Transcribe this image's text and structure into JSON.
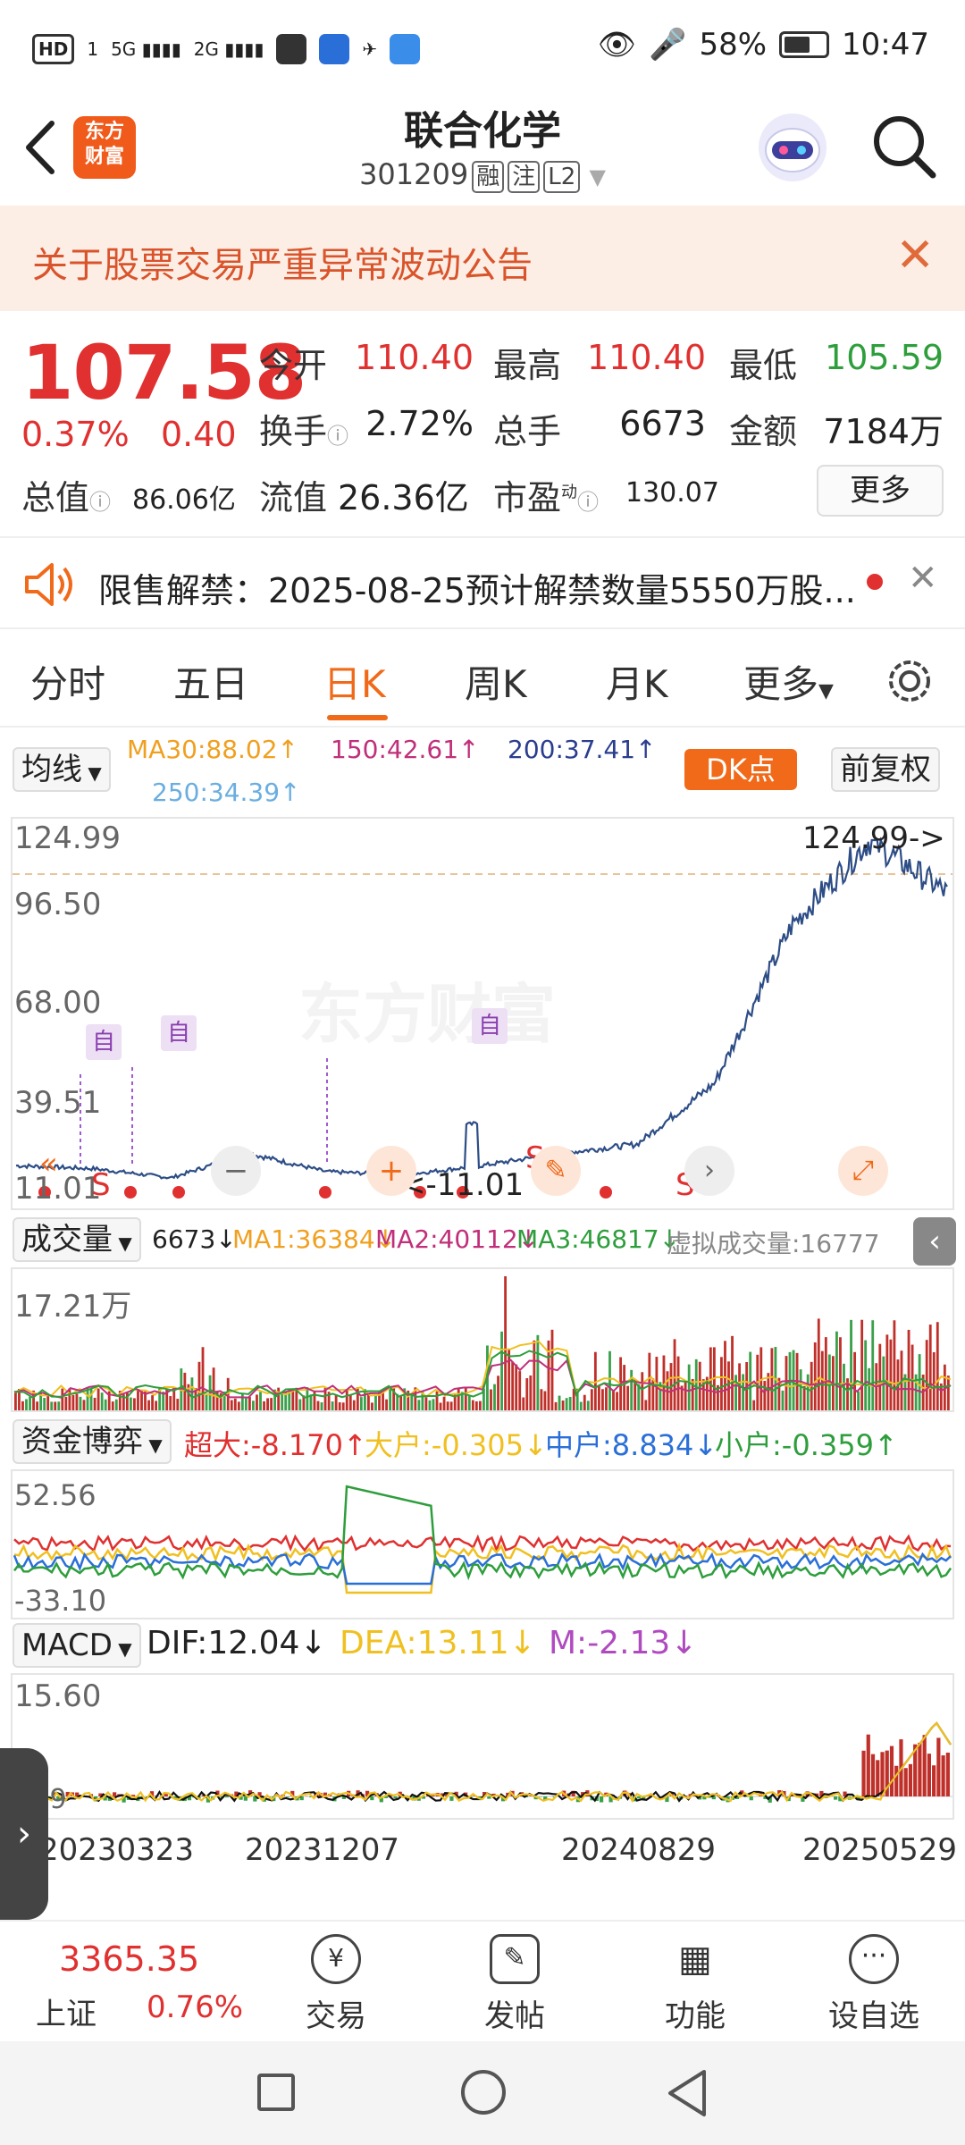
{
  "status_bar": {
    "hd": "HD",
    "sim": "1",
    "net1": "5G",
    "net2": "2G",
    "battery_pct": "58%",
    "time": "10:47"
  },
  "header": {
    "title": "联合化学",
    "code": "301209",
    "tags": [
      "融",
      "注",
      "L2"
    ],
    "logo_text": "东方财富"
  },
  "notice": {
    "text": "关于股票交易严重异常波动公告"
  },
  "quote": {
    "price": "107.58",
    "change_pct": "0.37%",
    "change": "0.40",
    "open_label": "今开",
    "open": "110.40",
    "high_label": "最高",
    "high": "110.40",
    "low_label": "最低",
    "low": "105.59",
    "turnover_label": "换手",
    "turnover": "2.72%",
    "volume_label": "总手",
    "volume": "6673",
    "amount_label": "金额",
    "amount": "7184万",
    "mktcap_label": "总值",
    "mktcap": "86.06亿",
    "float_label": "流值",
    "float": "26.36亿",
    "pe_label": "市盈",
    "pe_sup": "动",
    "pe": "130.07",
    "more": "更多"
  },
  "restriction": {
    "text": "限售解禁：2025-08-25预计解禁数量5550万股..."
  },
  "tabs": [
    "分时",
    "五日",
    "日K",
    "周K",
    "月K",
    "更多"
  ],
  "active_tab": "日K",
  "ma": {
    "select": "均线",
    "ma30": "MA30:88.02↑",
    "ma150": "150:42.61↑",
    "ma200": "200:37.41↑",
    "ma250": "250:34.39↑",
    "dk": "DK点",
    "fq": "前复权"
  },
  "kchart": {
    "y_labels": [
      "124.99",
      "96.50",
      "68.00",
      "39.51",
      "11.01"
    ],
    "max_marker": "124.99->",
    "min_marker": "<-11.01",
    "tag": "自",
    "sell_tag": "S",
    "watermark": "东方财富"
  },
  "volume_panel": {
    "select": "成交量",
    "vol": "6673↓",
    "ma1": "MA1:36384↓",
    "ma2": "MA2:40112↓",
    "ma3": "MA3:46817↓",
    "virtual": "虚拟成交量:16777",
    "ymax": "17.21万"
  },
  "fund_panel": {
    "select": "资金博弈",
    "super": "超大:-8.170↑",
    "big": "大户:-0.305↓",
    "mid": "中户:8.834↓",
    "small": "小户:-0.359↑",
    "ymax": "52.56",
    "ymin": "-33.10"
  },
  "macd_panel": {
    "select": "MACD",
    "dif": "DIF:12.04↓",
    "dea": "DEA:13.11↓",
    "m": "M:-2.13↓",
    "ymax": "15.60",
    "ymin": "-.79"
  },
  "dates": [
    "20230323",
    "20231207",
    "20240829",
    "20250529"
  ],
  "bottom_nav": {
    "index_value": "3365.35",
    "index_name": "上证",
    "index_pct": "0.76%",
    "items": [
      "交易",
      "发帖",
      "功能",
      "设自选"
    ]
  },
  "colors": {
    "accent": "#f06a1a",
    "up": "#e03030",
    "down": "#2e9e3c",
    "kline": "#2d4d86",
    "ma30": "#f0a020",
    "ma150": "#c0307a",
    "ma200": "#2a3d8f",
    "ma250": "#6aaee0"
  },
  "chart_data": [
    {
      "type": "line",
      "title": "",
      "ylim": [
        11.01,
        124.99
      ],
      "x": [
        "20230323",
        "20231207",
        "20240829",
        "20250529"
      ],
      "series": [
        {
          "values": [
            18,
            17,
            14,
            22,
            16,
            15,
            18,
            22,
            25,
            45,
            97,
            124.99,
            107.58
          ]
        }
      ]
    },
    {
      "type": "bar",
      "title": "",
      "ylim": [
        0,
        172100
      ],
      "series": [
        {
          "name": "MA1",
          "values": [
            36384
          ]
        },
        {
          "name": "MA2",
          "values": [
            40112
          ]
        },
        {
          "name": "MA3",
          "values": [
            46817
          ]
        }
      ]
    },
    {
      "type": "line",
      "title": "",
      "ylim": [
        -33.1,
        52.56
      ],
      "series": [
        {
          "name": "超大",
          "values": [
            -8.17
          ]
        },
        {
          "name": "大户",
          "values": [
            -0.305
          ]
        },
        {
          "name": "中户",
          "values": [
            8.834
          ]
        },
        {
          "name": "小户",
          "values": [
            -0.359
          ]
        }
      ]
    },
    {
      "type": "line",
      "title": "",
      "ylim": [
        -0.79,
        15.6
      ],
      "series": [
        {
          "name": "DIF",
          "values": [
            12.04
          ]
        },
        {
          "name": "DEA",
          "values": [
            13.11
          ]
        },
        {
          "name": "M",
          "values": [
            -2.13
          ]
        }
      ]
    }
  ]
}
